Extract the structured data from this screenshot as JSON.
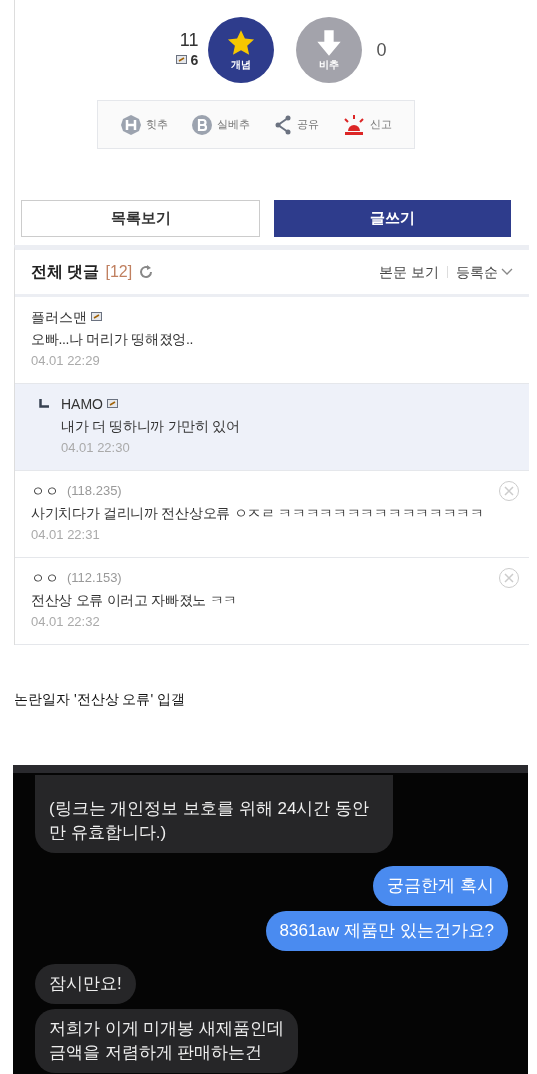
{
  "post": {
    "upvote_count": "11",
    "comment_count": "6",
    "upvote_label": "개념",
    "downvote_label": "비추",
    "downvote_count": "0",
    "actions": [
      {
        "kind": "hit",
        "label": "힛추"
      },
      {
        "kind": "best",
        "label": "실베추"
      },
      {
        "kind": "share",
        "label": "공유"
      },
      {
        "kind": "report",
        "label": "신고"
      }
    ],
    "buttons": [
      {
        "kind": "secondary",
        "label": "목록보기"
      },
      {
        "kind": "primary",
        "label": "글쓰기"
      }
    ]
  },
  "comments": {
    "title": "전체 댓글",
    "count": "[12]",
    "view_post": "본문 보기",
    "sort": "등록순",
    "items": [
      {
        "kind": "member",
        "reply": false,
        "author": "플러스맨",
        "text": "오빠...나 머리가 띵해졌엉..",
        "time": "04.01 22:29"
      },
      {
        "kind": "member",
        "reply": true,
        "author": "HAMO",
        "text": "내가 더 띵하니까 가만히 있어",
        "time": "04.01 22:30"
      },
      {
        "kind": "guest",
        "reply": false,
        "author": "ㅇㅇ",
        "ip": "(118.235)",
        "text": "사기치다가 걸리니까 전산상오류 ㅇㅈㄹ ㅋㅋㅋㅋㅋㅋㅋㅋㅋㅋㅋㅋㅋㅋㅋ",
        "time": "04.01 22:31"
      },
      {
        "kind": "guest",
        "reply": false,
        "author": "ㅇㅇ",
        "ip": "(112.153)",
        "text": "전산상 오류 이러고 자빠졌노 ㅋㅋ",
        "time": "04.01 22:32"
      }
    ]
  },
  "caption": "논란일자 '전산상 오류' 입갤",
  "chat": [
    {
      "kind": "received",
      "lines": [
        "(링크는 개인정보 보호를 위해 24시간 동안",
        "만 유효합니다.)"
      ]
    },
    {
      "kind": "sent",
      "lines": [
        "궁금한게 혹시"
      ]
    },
    {
      "kind": "sent",
      "lines": [
        "8361aw 제품만 있는건가요?"
      ]
    },
    {
      "kind": "received",
      "lines": [
        "잠시만요!"
      ]
    },
    {
      "kind": "received",
      "lines": [
        "저희가 이게 미개봉 새제품인데",
        "금액을 저렴하게 판매하는건"
      ]
    }
  ]
}
